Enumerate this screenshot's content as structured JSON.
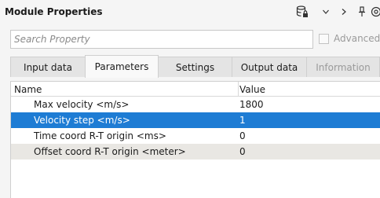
{
  "panel": {
    "title": "Module Properties",
    "toolbar": {
      "db_icon": "database-lock-icon",
      "dropdown_glyph": "v",
      "next_glyph": ">",
      "pin_glyph": "†",
      "extra_glyph": "@"
    }
  },
  "search": {
    "placeholder": "Search Property",
    "value": "",
    "advanced_label": "Advanced",
    "advanced_checked": false
  },
  "tabs": [
    {
      "label": "Input data",
      "active": false,
      "enabled": true
    },
    {
      "label": "Parameters",
      "active": true,
      "enabled": true
    },
    {
      "label": "Settings",
      "active": false,
      "enabled": true
    },
    {
      "label": "Output data",
      "active": false,
      "enabled": true
    },
    {
      "label": "Information",
      "active": false,
      "enabled": false
    }
  ],
  "grid": {
    "columns": [
      "Name",
      "Value"
    ],
    "rows": [
      {
        "name": "Max velocity <m/s>",
        "value": "1800",
        "selected": false
      },
      {
        "name": "Velocity step <m/s>",
        "value": "1",
        "selected": true
      },
      {
        "name": "Time coord R-T origin <ms>",
        "value": "0",
        "selected": false
      },
      {
        "name": "Offset coord R-T origin <meter>",
        "value": "0",
        "selected": false
      }
    ]
  },
  "colors": {
    "selection": "#1e7cd4",
    "alt_row": "#e9e7e3",
    "background": "#f5f5f5"
  }
}
